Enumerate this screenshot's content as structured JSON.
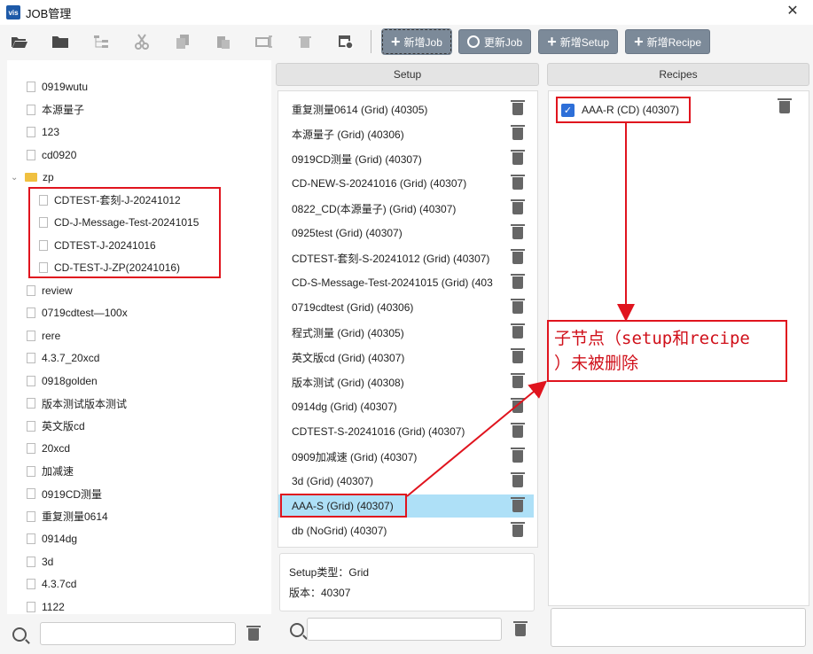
{
  "window": {
    "logo_text": "vis",
    "title": "JOB管理",
    "close_glyph": "✕"
  },
  "toolbar": {
    "icons": [
      "open-folder-icon",
      "folder-icon",
      "tree-icon",
      "cut-icon",
      "copy-icon",
      "paste-icon",
      "rename-icon",
      "delete-icon",
      "calendar-icon"
    ],
    "buttons": {
      "new_job": "新增Job",
      "update_job": "更新Job",
      "new_setup": "新增Setup",
      "new_recipe": "新增Recipe"
    }
  },
  "tree": {
    "items": [
      {
        "label": "0919wutu",
        "type": "file"
      },
      {
        "label": "本源量子",
        "type": "file"
      },
      {
        "label": "123",
        "type": "file"
      },
      {
        "label": "cd0920",
        "type": "file"
      },
      {
        "label": "zp",
        "type": "folder",
        "expanded": true
      },
      {
        "label": "CDTEST-套刻-J-20241012",
        "type": "file",
        "child": true
      },
      {
        "label": "CD-J-Message-Test-20241015",
        "type": "file",
        "child": true
      },
      {
        "label": "CDTEST-J-20241016",
        "type": "file",
        "child": true
      },
      {
        "label": "CD-TEST-J-ZP(20241016)",
        "type": "file",
        "child": true
      },
      {
        "label": "review",
        "type": "file"
      },
      {
        "label": "0719cdtest—100x",
        "type": "file"
      },
      {
        "label": "rere",
        "type": "file"
      },
      {
        "label": "4.3.7_20xcd",
        "type": "file"
      },
      {
        "label": "0918golden",
        "type": "file"
      },
      {
        "label": "版本测试版本测试",
        "type": "file"
      },
      {
        "label": "英文版cd",
        "type": "file"
      },
      {
        "label": "20xcd",
        "type": "file"
      },
      {
        "label": "加减速",
        "type": "file"
      },
      {
        "label": "0919CD测量",
        "type": "file"
      },
      {
        "label": "重复测量0614",
        "type": "file"
      },
      {
        "label": "0914dg",
        "type": "file"
      },
      {
        "label": "3d",
        "type": "file"
      },
      {
        "label": "4.3.7cd",
        "type": "file"
      },
      {
        "label": "1122",
        "type": "file"
      }
    ]
  },
  "setup": {
    "header": "Setup",
    "items": [
      "重复测量0614 (Grid) (40305)",
      "本源量子 (Grid) (40306)",
      "0919CD测量 (Grid) (40307)",
      "CD-NEW-S-20241016 (Grid) (40307)",
      "0822_CD(本源量子) (Grid) (40307)",
      "0925test (Grid) (40307)",
      "CDTEST-套刻-S-20241012 (Grid) (40307)",
      "CD-S-Message-Test-20241015 (Grid) (403",
      "0719cdtest (Grid) (40306)",
      "程式测量 (Grid) (40305)",
      "英文版cd (Grid) (40307)",
      "版本测试 (Grid) (40308)",
      "0914dg (Grid) (40307)",
      "CDTEST-S-20241016 (Grid) (40307)",
      "0909加减速 (Grid) (40307)",
      "3d (Grid) (40307)",
      "AAA-S (Grid) (40307)",
      "db (NoGrid) (40307)"
    ],
    "selected_index": 16,
    "info": {
      "type_line": "Setup类型：Grid",
      "version_line": "版本：40307"
    }
  },
  "recipes": {
    "header": "Recipes",
    "items": [
      {
        "label": "AAA-R (CD) (40307)",
        "checked": true
      }
    ]
  },
  "annotation": {
    "text_line1": "子节点（setup和recipe",
    "text_line2": "）未被删除",
    "color": "#e0141e"
  }
}
